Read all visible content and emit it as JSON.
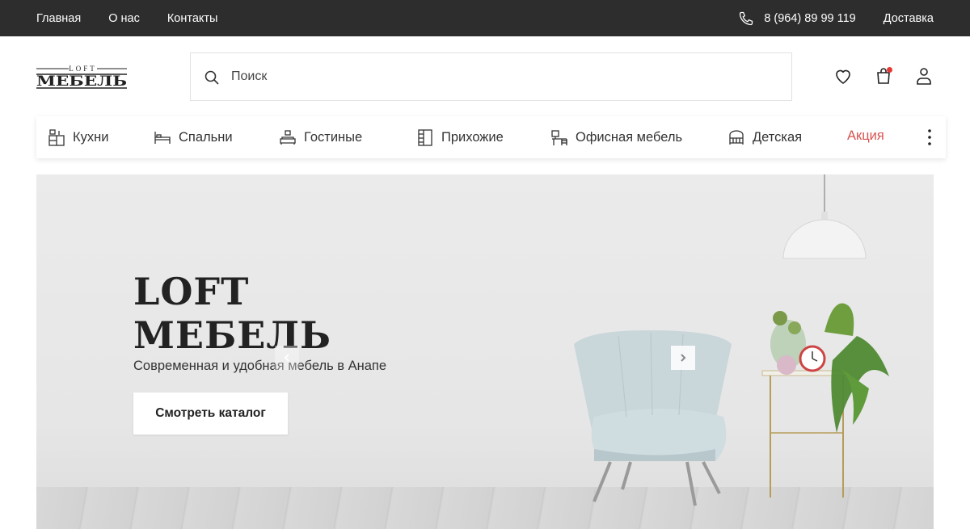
{
  "topbar": {
    "nav": [
      "Главная",
      "О нас",
      "Контакты"
    ],
    "phone": "8 (964) 89 99 119",
    "delivery": "Доставка"
  },
  "header": {
    "logo_top": "LOFT",
    "logo_main": "МЕБЕЛЬ",
    "search_placeholder": "Поиск",
    "icons": [
      "heart-icon",
      "cart-icon",
      "user-icon"
    ]
  },
  "categories": [
    {
      "label": "Кухни",
      "icon": "kitchen-icon"
    },
    {
      "label": "Спальни",
      "icon": "bed-icon"
    },
    {
      "label": "Гостиные",
      "icon": "living-room-icon"
    },
    {
      "label": "Прихожие",
      "icon": "wardrobe-icon"
    },
    {
      "label": "Офисная мебель",
      "icon": "office-icon"
    },
    {
      "label": "Детская",
      "icon": "crib-icon"
    },
    {
      "label": "Акция",
      "icon": ""
    }
  ],
  "hero": {
    "title_line1": "LOFT",
    "title_line2": "МЕБЕЛЬ",
    "subtitle": "Современная и удобная мебель в Анапе",
    "button": "Смотреть каталог"
  },
  "colors": {
    "topbar_bg": "#2d2d2d",
    "sale": "#d9534f",
    "cart_badge": "#e53935"
  }
}
